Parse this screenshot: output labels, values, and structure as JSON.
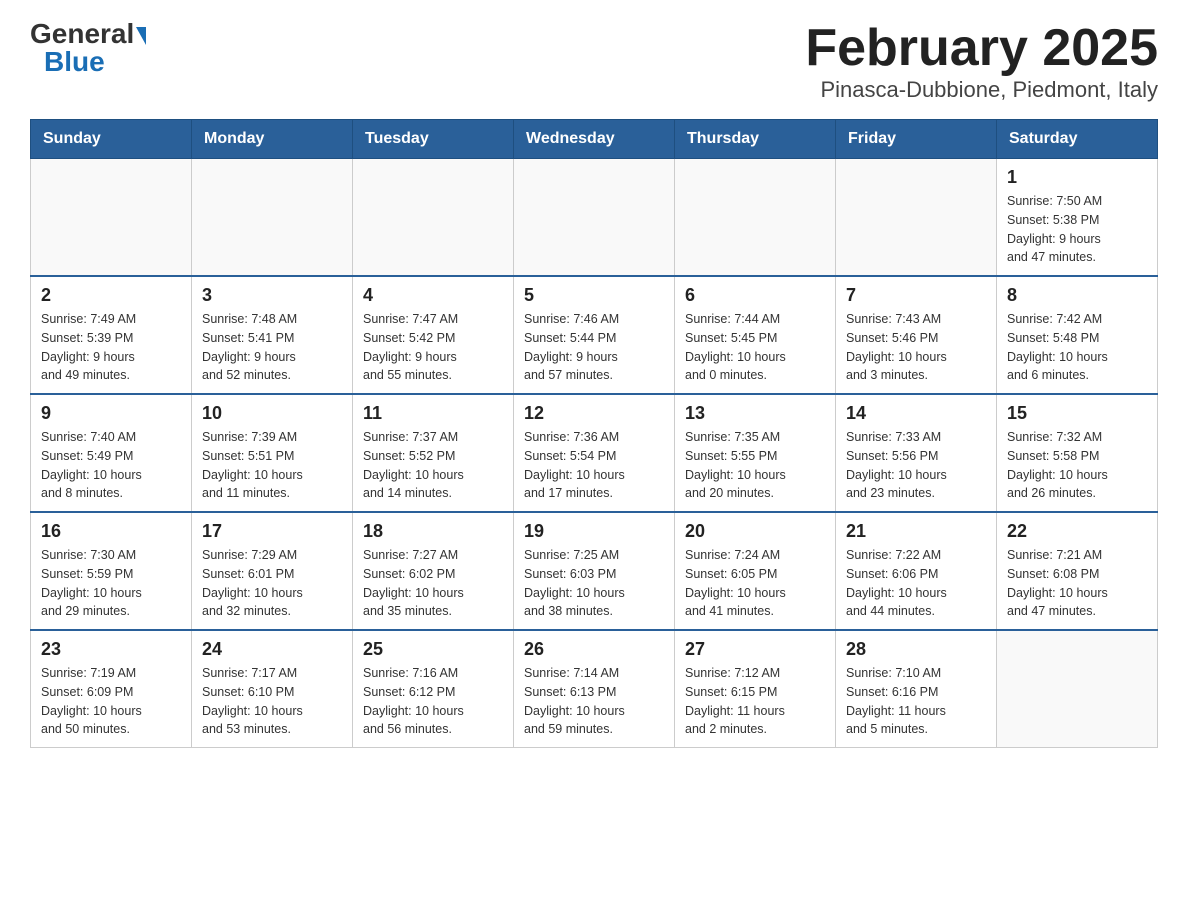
{
  "logo": {
    "general": "General",
    "blue": "Blue",
    "triangle": true
  },
  "title": "February 2025",
  "subtitle": "Pinasca-Dubbione, Piedmont, Italy",
  "days_of_week": [
    "Sunday",
    "Monday",
    "Tuesday",
    "Wednesday",
    "Thursday",
    "Friday",
    "Saturday"
  ],
  "weeks": [
    [
      {
        "day": "",
        "info": ""
      },
      {
        "day": "",
        "info": ""
      },
      {
        "day": "",
        "info": ""
      },
      {
        "day": "",
        "info": ""
      },
      {
        "day": "",
        "info": ""
      },
      {
        "day": "",
        "info": ""
      },
      {
        "day": "1",
        "info": "Sunrise: 7:50 AM\nSunset: 5:38 PM\nDaylight: 9 hours\nand 47 minutes."
      }
    ],
    [
      {
        "day": "2",
        "info": "Sunrise: 7:49 AM\nSunset: 5:39 PM\nDaylight: 9 hours\nand 49 minutes."
      },
      {
        "day": "3",
        "info": "Sunrise: 7:48 AM\nSunset: 5:41 PM\nDaylight: 9 hours\nand 52 minutes."
      },
      {
        "day": "4",
        "info": "Sunrise: 7:47 AM\nSunset: 5:42 PM\nDaylight: 9 hours\nand 55 minutes."
      },
      {
        "day": "5",
        "info": "Sunrise: 7:46 AM\nSunset: 5:44 PM\nDaylight: 9 hours\nand 57 minutes."
      },
      {
        "day": "6",
        "info": "Sunrise: 7:44 AM\nSunset: 5:45 PM\nDaylight: 10 hours\nand 0 minutes."
      },
      {
        "day": "7",
        "info": "Sunrise: 7:43 AM\nSunset: 5:46 PM\nDaylight: 10 hours\nand 3 minutes."
      },
      {
        "day": "8",
        "info": "Sunrise: 7:42 AM\nSunset: 5:48 PM\nDaylight: 10 hours\nand 6 minutes."
      }
    ],
    [
      {
        "day": "9",
        "info": "Sunrise: 7:40 AM\nSunset: 5:49 PM\nDaylight: 10 hours\nand 8 minutes."
      },
      {
        "day": "10",
        "info": "Sunrise: 7:39 AM\nSunset: 5:51 PM\nDaylight: 10 hours\nand 11 minutes."
      },
      {
        "day": "11",
        "info": "Sunrise: 7:37 AM\nSunset: 5:52 PM\nDaylight: 10 hours\nand 14 minutes."
      },
      {
        "day": "12",
        "info": "Sunrise: 7:36 AM\nSunset: 5:54 PM\nDaylight: 10 hours\nand 17 minutes."
      },
      {
        "day": "13",
        "info": "Sunrise: 7:35 AM\nSunset: 5:55 PM\nDaylight: 10 hours\nand 20 minutes."
      },
      {
        "day": "14",
        "info": "Sunrise: 7:33 AM\nSunset: 5:56 PM\nDaylight: 10 hours\nand 23 minutes."
      },
      {
        "day": "15",
        "info": "Sunrise: 7:32 AM\nSunset: 5:58 PM\nDaylight: 10 hours\nand 26 minutes."
      }
    ],
    [
      {
        "day": "16",
        "info": "Sunrise: 7:30 AM\nSunset: 5:59 PM\nDaylight: 10 hours\nand 29 minutes."
      },
      {
        "day": "17",
        "info": "Sunrise: 7:29 AM\nSunset: 6:01 PM\nDaylight: 10 hours\nand 32 minutes."
      },
      {
        "day": "18",
        "info": "Sunrise: 7:27 AM\nSunset: 6:02 PM\nDaylight: 10 hours\nand 35 minutes."
      },
      {
        "day": "19",
        "info": "Sunrise: 7:25 AM\nSunset: 6:03 PM\nDaylight: 10 hours\nand 38 minutes."
      },
      {
        "day": "20",
        "info": "Sunrise: 7:24 AM\nSunset: 6:05 PM\nDaylight: 10 hours\nand 41 minutes."
      },
      {
        "day": "21",
        "info": "Sunrise: 7:22 AM\nSunset: 6:06 PM\nDaylight: 10 hours\nand 44 minutes."
      },
      {
        "day": "22",
        "info": "Sunrise: 7:21 AM\nSunset: 6:08 PM\nDaylight: 10 hours\nand 47 minutes."
      }
    ],
    [
      {
        "day": "23",
        "info": "Sunrise: 7:19 AM\nSunset: 6:09 PM\nDaylight: 10 hours\nand 50 minutes."
      },
      {
        "day": "24",
        "info": "Sunrise: 7:17 AM\nSunset: 6:10 PM\nDaylight: 10 hours\nand 53 minutes."
      },
      {
        "day": "25",
        "info": "Sunrise: 7:16 AM\nSunset: 6:12 PM\nDaylight: 10 hours\nand 56 minutes."
      },
      {
        "day": "26",
        "info": "Sunrise: 7:14 AM\nSunset: 6:13 PM\nDaylight: 10 hours\nand 59 minutes."
      },
      {
        "day": "27",
        "info": "Sunrise: 7:12 AM\nSunset: 6:15 PM\nDaylight: 11 hours\nand 2 minutes."
      },
      {
        "day": "28",
        "info": "Sunrise: 7:10 AM\nSunset: 6:16 PM\nDaylight: 11 hours\nand 5 minutes."
      },
      {
        "day": "",
        "info": ""
      }
    ]
  ]
}
